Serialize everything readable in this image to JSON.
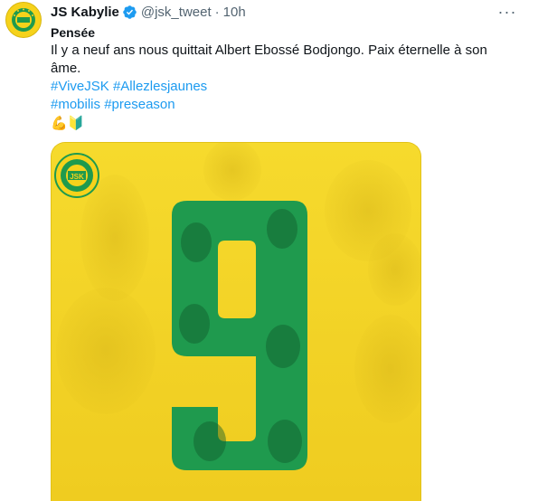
{
  "account": {
    "display_name": "JS Kabylie",
    "handle": "@jsk_tweet",
    "separator": "·",
    "time": "10h",
    "verified_color": "#1d9bf0",
    "more_label": "···"
  },
  "tweet": {
    "heading": "Pensée",
    "text_line1": "Il y a neuf ans nous quittait Albert Ebossé Bodjongo. Paix éternelle à son",
    "text_line2": "âme.",
    "hashtags_line1": [
      "#ViveJSK",
      "#Allezlesjaunes"
    ],
    "hashtags_line2": [
      "#mobilis",
      "#preseason"
    ],
    "emojis": "💪🔰"
  },
  "media": {
    "description_icon": "jsk-tribute-image",
    "number": "9",
    "crest_text": "JSK",
    "colors": {
      "background": "#f3d62a",
      "green": "#1f9a4e"
    }
  },
  "colors": {
    "link": "#1d9bf0",
    "text": "#0f1419",
    "muted": "#536471"
  }
}
